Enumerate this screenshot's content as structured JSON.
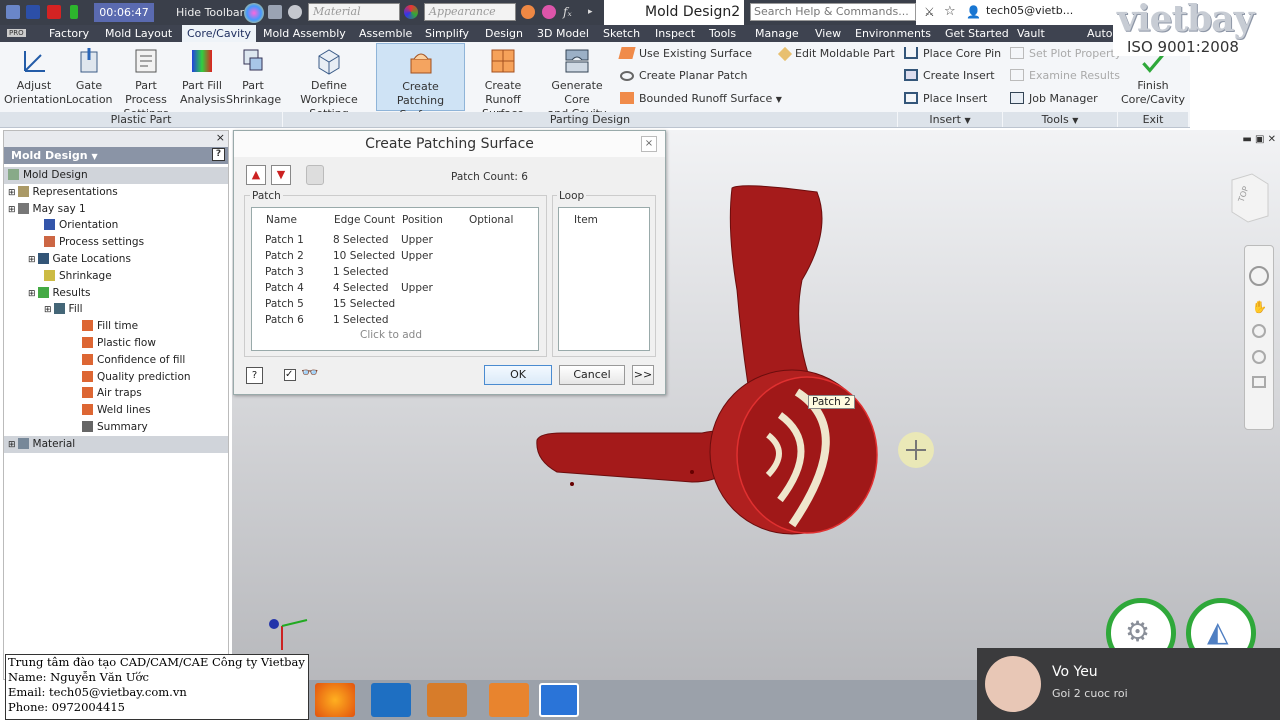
{
  "qat": {
    "timer": "00:06:47",
    "hide_toolbar": "Hide Toolbar",
    "material_placeholder": "Material",
    "appearance_placeholder": "Appearance",
    "doc_title": "Mold Design2",
    "search_placeholder": "Search Help & Commands...",
    "user": "tech05@vietb..."
  },
  "pro_badge": "PRO",
  "tabs": [
    "Factory",
    "Mold Layout",
    "Core/Cavity",
    "Mold Assembly",
    "Assemble",
    "Simplify",
    "Design",
    "3D Model",
    "Sketch",
    "Inspect",
    "Tools",
    "Manage",
    "View",
    "Environments",
    "Get Started",
    "Vault",
    "Autodesk"
  ],
  "active_tab": "Core/Cavity",
  "logo": {
    "brand": "vietbay",
    "iso": "ISO 9001:2008"
  },
  "ribbon": {
    "plastic_part": {
      "group_label": "Plastic Part",
      "buttons": [
        {
          "label1": "Adjust",
          "label2": "Orientation"
        },
        {
          "label1": "Gate",
          "label2": "Location"
        },
        {
          "label1": "Part Process",
          "label2": "Settings"
        },
        {
          "label1": "Part Fill",
          "label2": "Analysis"
        },
        {
          "label1": "Part",
          "label2": "Shrinkage"
        }
      ]
    },
    "parting_design": {
      "group_label": "Parting Design",
      "buttons": [
        {
          "label1": "Define Workpiece",
          "label2": "Setting"
        },
        {
          "label1": "Create",
          "label2": "Patching Surface"
        },
        {
          "label1": "Create Runoff",
          "label2": "Surface"
        },
        {
          "label1": "Generate Core",
          "label2": "and Cavity"
        }
      ],
      "small": [
        "Use Existing Surface",
        "Create Planar Patch",
        "Bounded Runoff Surface",
        "Edit Moldable Part"
      ]
    },
    "insert": {
      "group_label": "Insert",
      "small": [
        "Place Core Pin",
        "Create Insert",
        "Place Insert"
      ]
    },
    "tools": {
      "group_label": "Tools",
      "small": [
        "Set Plot Property",
        "Examine Results",
        "Job Manager"
      ]
    },
    "exit": {
      "group_label": "Exit",
      "label1": "Finish",
      "label2": "Core/Cavity"
    }
  },
  "browser": {
    "header": "Mold Design",
    "items": [
      "Mold Design",
      "Representations",
      "May say 1",
      "Orientation",
      "Process settings",
      "Gate Locations",
      "Shrinkage",
      "Results",
      "Fill",
      "Fill time",
      "Plastic flow",
      "Confidence of fill",
      "Quality prediction",
      "Air traps",
      "Weld lines",
      "Summary",
      "Material"
    ]
  },
  "dialog": {
    "title": "Create Patching Surface",
    "patch_count": "Patch Count: 6",
    "patch_label": "Patch",
    "loop_label": "Loop",
    "columns": [
      "Name",
      "Edge Count",
      "Position",
      "Optional"
    ],
    "rows": [
      {
        "name": "Patch 1",
        "edges": "8 Selected",
        "position": "Upper"
      },
      {
        "name": "Patch 2",
        "edges": "10 Selected",
        "position": "Upper"
      },
      {
        "name": "Patch 3",
        "edges": "1 Selected",
        "position": ""
      },
      {
        "name": "Patch 4",
        "edges": "4 Selected",
        "position": "Upper"
      },
      {
        "name": "Patch 5",
        "edges": "15 Selected",
        "position": ""
      },
      {
        "name": "Patch 6",
        "edges": "1 Selected",
        "position": ""
      }
    ],
    "click_to_add": "Click to add",
    "loop_column": "Item",
    "ok": "OK",
    "cancel": "Cancel",
    "more": ">>"
  },
  "viewport": {
    "tooltip": "Patch 2",
    "viewcube": "TOP"
  },
  "signature": {
    "line1": "Trung tâm đào tạo CAD/CAM/CAE Công ty Vietbay",
    "line2": "Name: Nguyễn Văn Ước",
    "line3": "Email: tech05@vietbay.com.vn",
    "line4": "Phone: 0972004415"
  },
  "notification": {
    "name": "Vo Yeu",
    "message": "Goi 2 cuoc roi"
  },
  "colors": {
    "part": "#a51b1b",
    "accent": "#4a8bd0",
    "ribbon_bg": "#f4f6f9"
  }
}
